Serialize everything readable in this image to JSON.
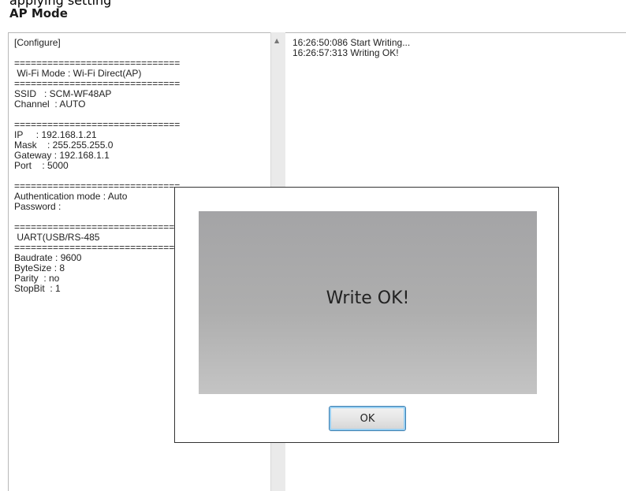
{
  "header": {
    "cut_text": "applying setting",
    "title": "AP Mode"
  },
  "config": {
    "text": "[Configure]\n\n==============================\n Wi-Fi Mode : Wi-Fi Direct(AP)\n==============================\nSSID   : SCM-WF48AP\nChannel  : AUTO\n\n==============================\nIP     : 192.168.1.21\nMask    : 255.255.255.0\nGateway : 192.168.1.1\nPort    : 5000\n\n==============================\nAuthentication mode : Auto\nPassword :\n\n==============================\n UART(USB/RS-485\n==============================\nBaudrate : 9600\nByteSize : 8\nParity  : no\nStopBit  : 1"
  },
  "scrollbar": {
    "up_arrow": "▲"
  },
  "log": {
    "entries": [
      "16:26:50:086 Start Writing...",
      "16:26:57:313 Writing OK!"
    ]
  },
  "dialog": {
    "message": "Write OK!",
    "ok_label": "OK"
  }
}
